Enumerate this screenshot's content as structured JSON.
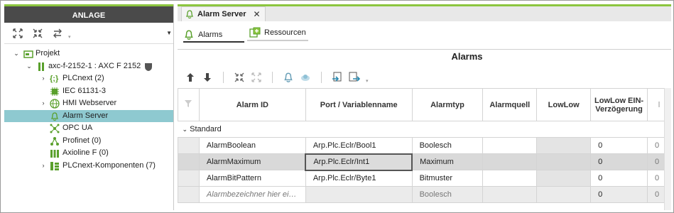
{
  "left_panel": {
    "title": "ANLAGE",
    "toolbar_icons": [
      "expand-all-icon",
      "collapse-all-icon",
      "sync-icon"
    ],
    "tree": [
      {
        "label": "Projekt",
        "icon": "project-icon",
        "expanded": true
      },
      {
        "label": "axc-f-2152-1 : AXC F 2152",
        "icon": "controller-icon",
        "expanded": true
      },
      {
        "label": "PLCnext (2)",
        "icon": "braces-icon",
        "expanded": false
      },
      {
        "label": "IEC 61131-3",
        "icon": "chip-icon"
      },
      {
        "label": "HMI Webserver",
        "icon": "globe-icon",
        "expanded": false
      },
      {
        "label": "Alarm Server",
        "icon": "bell-icon",
        "selected": true
      },
      {
        "label": "OPC UA",
        "icon": "network-icon"
      },
      {
        "label": "Profinet (0)",
        "icon": "profinet-icon"
      },
      {
        "label": "Axioline F (0)",
        "icon": "axioline-icon"
      },
      {
        "label": "PLCnext-Komponenten (7)",
        "icon": "components-icon",
        "expanded": false
      }
    ]
  },
  "editor": {
    "tab_label": "Alarm Server",
    "subtabs": [
      "Alarms",
      "Ressourcen"
    ],
    "title": "Alarms",
    "columns": [
      "Alarm ID",
      "Port / Variablenname",
      "Alarmtyp",
      "Alarmquell",
      "LowLow",
      "LowLow EIN-Verzögerung"
    ],
    "group": "Standard",
    "rows": [
      {
        "id": "AlarmBoolean",
        "port": "Arp.Plc.Eclr/Bool1",
        "type": "Boolesch",
        "source": "",
        "lowlow": "",
        "delay": "0"
      },
      {
        "id": "AlarmMaximum",
        "port": "Arp.Plc.Eclr/Int1",
        "type": "Maximum",
        "source": "",
        "lowlow": "",
        "delay": "0"
      },
      {
        "id": "AlarmBitPattern",
        "port": "Arp.Plc.Eclr/Byte1",
        "type": "Bitmuster",
        "source": "",
        "lowlow": "",
        "delay": "0"
      },
      {
        "id": "Alarmbezeichner hier ei…",
        "port": "",
        "type": "Boolesch",
        "source": "",
        "lowlow": "",
        "delay": "0"
      }
    ]
  },
  "colors": {
    "accent": "#8cc63f",
    "selection": "#8ec9d0",
    "header_bg": "#4a4a4a"
  }
}
